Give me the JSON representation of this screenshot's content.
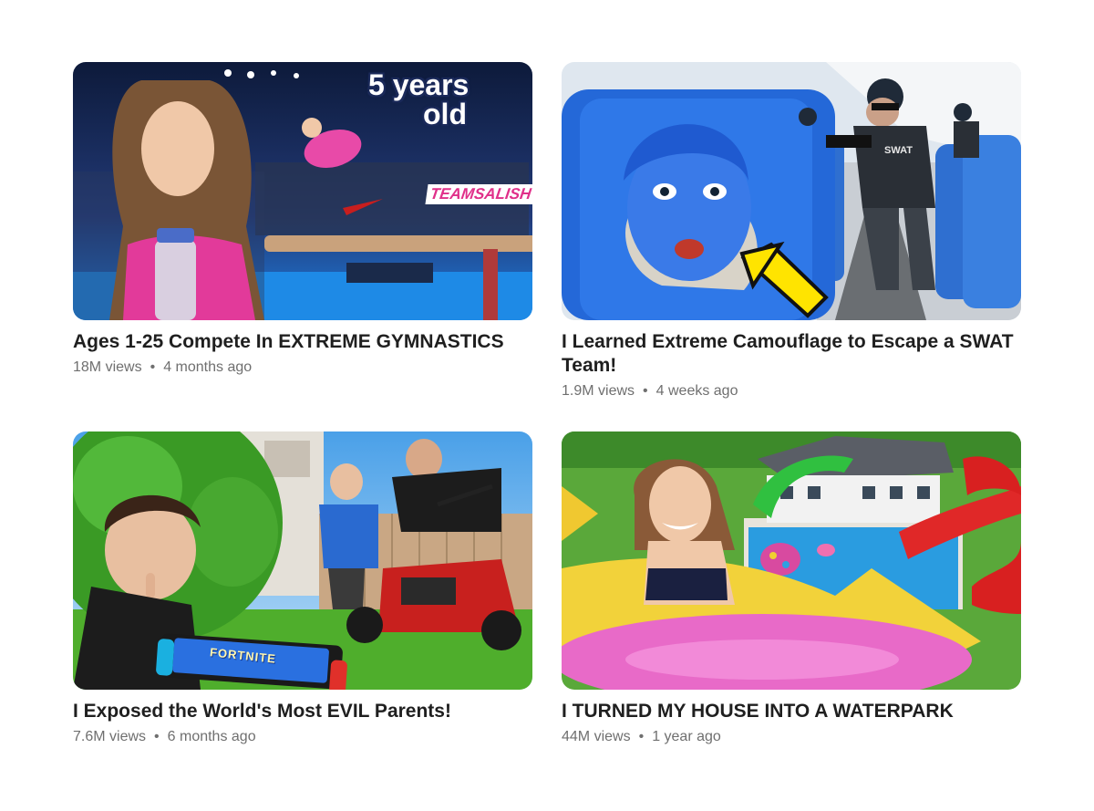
{
  "videos": [
    {
      "title": "Ages 1-25 Compete In EXTREME GYMNASTICS",
      "views": "18M views",
      "age": "4 months ago",
      "overlay": {
        "line1": "5 years",
        "line2": "old",
        "banner_a": "TEAM",
        "banner_b": "SALISH"
      }
    },
    {
      "title": "I Learned Extreme Camouflage to Escape a SWAT Team!",
      "views": "1.9M views",
      "age": "4 weeks ago",
      "overlay": {
        "vest": "SWAT"
      }
    },
    {
      "title": "I Exposed the World's Most EVIL Parents!",
      "views": "7.6M views",
      "age": "6 months ago",
      "overlay": {
        "switch_text": "FORTNITE"
      }
    },
    {
      "title": "I TURNED MY HOUSE INTO A WATERPARK",
      "views": "44M views",
      "age": "1 year ago"
    }
  ],
  "separator": "•"
}
